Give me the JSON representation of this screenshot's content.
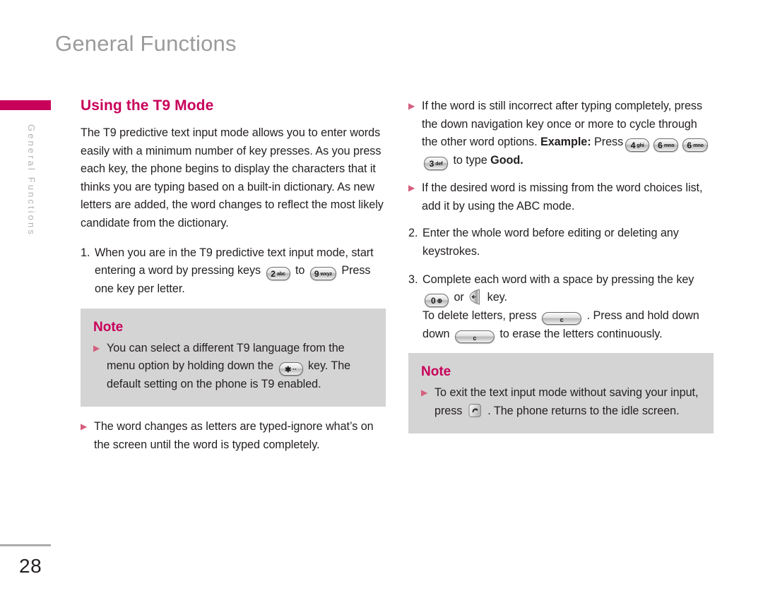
{
  "page": {
    "header_title": "General Functions",
    "side_tab_label": "General Functions",
    "page_number": "28",
    "accent_color": "#c8005a",
    "note_bg_color": "#d5d4d4",
    "bullet_color": "#d4607f"
  },
  "left_column": {
    "section_title": "Using the T9 Mode",
    "intro_paragraph": "The T9 predictive text input mode allows you to enter words easily with a minimum number of key presses. As you press each key, the phone begins to display the characters that it thinks you are typing based on a built-in dictionary. As new letters are added, the word changes to reflect the most likely candidate from the dictionary.",
    "step1": {
      "number": "1.",
      "text_a": "When you are in the T9 predictive text input mode, start entering a word by pressing keys",
      "key_from": {
        "digit": "2",
        "letters": "abc",
        "icon": "keypad-key-2-icon"
      },
      "text_b": "to",
      "key_to": {
        "digit": "9",
        "letters": "wxyz",
        "icon": "keypad-key-9-icon"
      },
      "text_c": "Press one key per letter."
    },
    "note": {
      "title": "Note",
      "text_a": "You can select a different T9 language from the menu option by holding down the",
      "key": {
        "digit": "✱",
        "letters": "··",
        "icon": "keypad-key-star-icon"
      },
      "text_b": "key. The default setting on the phone is T9 enabled."
    },
    "bullet": "The word changes as letters are typed-ignore what’s on the screen until the word is typed completely."
  },
  "right_column": {
    "bullet1": {
      "text_a": "If the word is still incorrect after typing completely, press the down navigation key once or more to cycle through the other word options.",
      "example_label": "Example:",
      "example_press": "Press",
      "example_keys": [
        {
          "digit": "4",
          "letters": "ghi",
          "icon": "keypad-key-4-icon"
        },
        {
          "digit": "6",
          "letters": "mno",
          "icon": "keypad-key-6-icon"
        },
        {
          "digit": "6",
          "letters": "mno",
          "icon": "keypad-key-6-icon"
        },
        {
          "digit": "3",
          "letters": "def",
          "icon": "keypad-key-3-icon"
        }
      ],
      "text_b": "to type",
      "result_word": "Good",
      "text_c": "."
    },
    "bullet2": "If the desired word is missing from the word choices list, add it by using the ABC mode.",
    "step2": {
      "number": "2.",
      "text": "Enter the whole word before editing or deleting any keystrokes."
    },
    "step3": {
      "number": "3.",
      "text_a": "Complete each word with a space by pressing the key",
      "key_zero": {
        "digit": "0",
        "letters": "⊕",
        "icon": "keypad-key-0-icon"
      },
      "text_b": "or",
      "key_nav": {
        "icon": "navigation-soft-key-icon"
      },
      "text_c": "key.",
      "text_d": "To delete letters, press",
      "key_clear_1": {
        "digit": "c",
        "icon": "clear-key-icon"
      },
      "text_e": ". Press and hold down",
      "key_clear_2": {
        "digit": "c",
        "icon": "clear-key-icon"
      },
      "text_f": "to erase the letters continuously."
    },
    "note": {
      "title": "Note",
      "text_a": "To exit the text input mode without saving your input, press",
      "key_end": {
        "icon": "end-call-key-icon"
      },
      "text_b": ". The phone returns to the idle screen."
    }
  }
}
